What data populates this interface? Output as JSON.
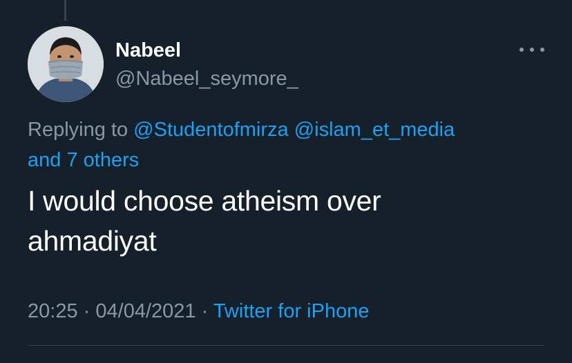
{
  "tweet": {
    "author": {
      "name": "Nabeel",
      "handle": "@Nabeel_seymore_"
    },
    "reply": {
      "prefix": "Replying to",
      "mentions": [
        "@Studentofmirza",
        "@islam_et_media"
      ],
      "others": "and 7 others"
    },
    "text_line1": "I would choose atheism over",
    "text_line2": "ahmadiyat",
    "time": "20:25",
    "date": "04/04/2021",
    "separator": "·",
    "source": "Twitter for iPhone"
  },
  "colors": {
    "background": "#15202b",
    "primary_text": "#ffffff",
    "secondary_text": "#8899a6",
    "accent": "#1da1f2",
    "divider": "#38444d"
  },
  "icons": {
    "more": "more-horizontal-icon",
    "avatar": "avatar"
  }
}
